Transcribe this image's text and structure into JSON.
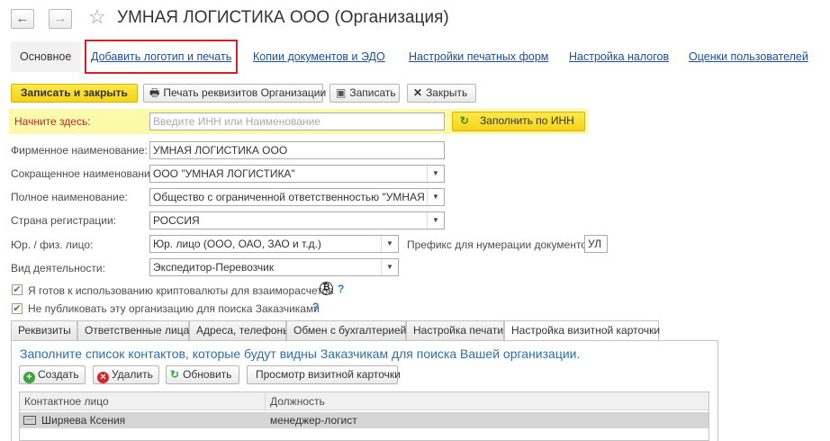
{
  "window": {
    "title": "УМНАЯ ЛОГИСТИКА ООО (Организация)"
  },
  "nav": {
    "back": "←",
    "forward": "→"
  },
  "tabs": [
    {
      "label": "Основное"
    },
    {
      "label": "Добавить логотип и печать"
    },
    {
      "label": "Копии документов и ЭДО"
    },
    {
      "label": "Настройки печатных форм"
    },
    {
      "label": "Настройка налогов"
    },
    {
      "label": "Оценки пользователей"
    }
  ],
  "toolbar": {
    "save_close": "Записать и закрыть",
    "print_details": "Печать реквизитов Организации",
    "save": "Записать",
    "close": "Закрыть"
  },
  "start": {
    "label": "Начните здесь:",
    "placeholder": "Введите ИНН или Наименование",
    "fill_button": "Заполнить по ИНН"
  },
  "form": {
    "firm_name_label": "Фирменное наименование:",
    "firm_name_value": "УМНАЯ ЛОГИСТИКА ООО",
    "short_name_label": "Сокращенное наименование:",
    "short_name_value": "ООО \"УМНАЯ ЛОГИСТИКА\"",
    "full_name_label": "Полное наименование:",
    "full_name_value": "Общество с ограниченной ответственностью \"УМНАЯ ЛОГИСТИКА\"",
    "country_label": "Страна регистрации:",
    "country_value": "РОССИЯ",
    "entity_label": "Юр. / физ. лицо:",
    "entity_value": "Юр. лицо (ООО, ОАО, ЗАО и т.д.)",
    "prefix_label": "Префикс для нумерации документов :",
    "prefix_value": "УЛ",
    "activity_label": "Вид деятельности:",
    "activity_value": "Экспедитор-Перевозчик",
    "crypto_label": "Я готов к использованию криптовалюты для взаиморасчетов",
    "no_publish_label": "Не публиковать эту организацию для поиска Заказчиками",
    "help": "?"
  },
  "subtabs": [
    {
      "label": "Реквизиты"
    },
    {
      "label": "Ответственные лица"
    },
    {
      "label": "Адреса, телефоны"
    },
    {
      "label": "Обмен с бухгалтерией"
    },
    {
      "label": "Настройка печати"
    },
    {
      "label": "Настройка визитной карточки"
    }
  ],
  "card": {
    "hint": "Заполните список контактов, которые будут видны Заказчикам для поиска Вашей организации.",
    "create": "Создать",
    "delete": "Удалить",
    "refresh": "Обновить",
    "preview": "Просмотр визитной карточки",
    "columns": [
      "Контактное лицо",
      "Должность"
    ],
    "rows": [
      {
        "contact": "Ширяева Ксения",
        "position": "менеджер-логист"
      }
    ]
  },
  "colors": {
    "accent_yellow": "#f5d31a",
    "highlight_red": "#d61f26",
    "link_blue": "#1d4f91"
  }
}
